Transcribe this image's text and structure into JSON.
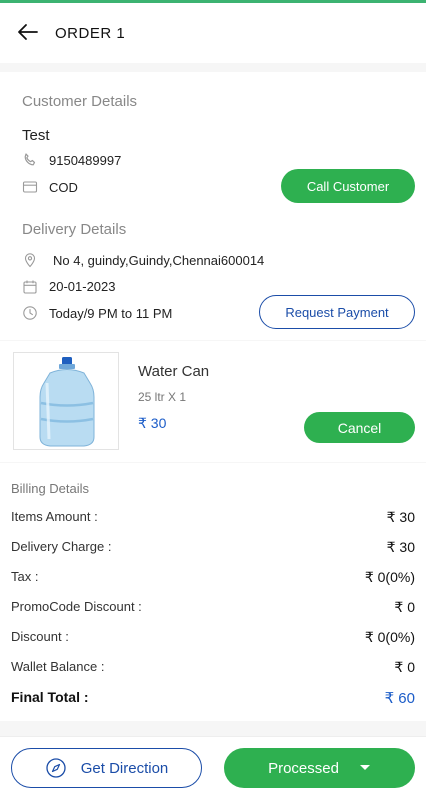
{
  "header": {
    "title": "ORDER 1"
  },
  "customer": {
    "section_title": "Customer Details",
    "name": "Test",
    "phone": "9150489997",
    "payment": "COD",
    "call_button": "Call Customer"
  },
  "delivery": {
    "section_title": "Delivery Details",
    "address": "No 4, guindy,Guindy,Chennai600014",
    "date": "20-01-2023",
    "slot": "Today/9 PM to 11 PM",
    "request_button": "Request Payment"
  },
  "product": {
    "name": "Water Can",
    "quantity": "25 ltr X 1",
    "price": "₹ 30",
    "cancel_button": "Cancel"
  },
  "billing": {
    "title": "Billing Details",
    "rows": [
      {
        "label": "Items Amount :",
        "value": "₹ 30"
      },
      {
        "label": "Delivery Charge :",
        "value": "₹ 30"
      },
      {
        "label": "Tax :",
        "value": "₹ 0(0%)"
      },
      {
        "label": "PromoCode Discount :",
        "value": "₹ 0"
      },
      {
        "label": "Discount :",
        "value": "₹ 0(0%)"
      },
      {
        "label": "Wallet Balance :",
        "value": "₹ 0"
      }
    ],
    "final": {
      "label": "Final Total :",
      "value": "₹ 60"
    }
  },
  "footer": {
    "direction_button": "Get Direction",
    "status_button": "Processed"
  },
  "icons": {
    "back": "arrow-left-icon",
    "phone": "phone-icon",
    "card": "credit-card-icon",
    "location": "location-pin-icon",
    "calendar": "calendar-icon",
    "clock": "clock-icon",
    "compass": "compass-icon",
    "caret": "caret-down-icon"
  },
  "colors": {
    "green": "#2eb050",
    "blue": "#1b4da8",
    "price_blue": "#1b5cc8"
  }
}
